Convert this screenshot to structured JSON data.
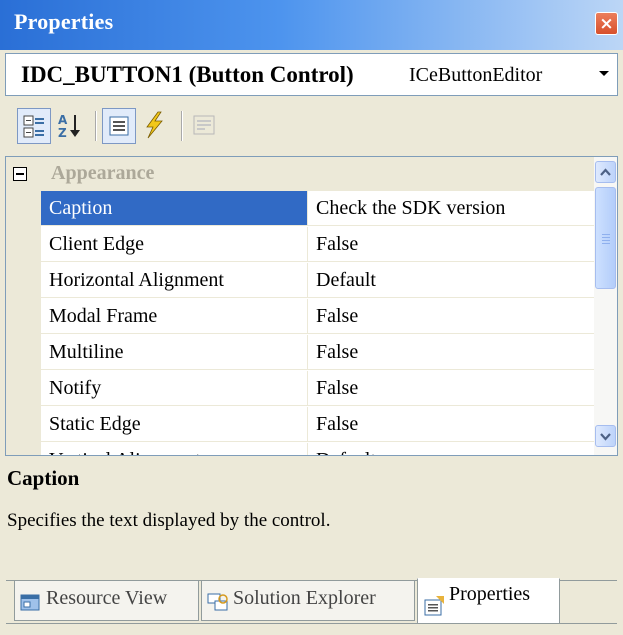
{
  "window": {
    "title": "Properties",
    "close_glyph": "×"
  },
  "object_selector": {
    "name": "IDC_BUTTON1",
    "type": "(Button Control)",
    "editor": "ICeButtonEditor"
  },
  "toolbar": {
    "buttons": [
      {
        "icon": "categorized-icon",
        "state": "pressed"
      },
      {
        "icon": "alphabetical-icon",
        "state": "normal"
      },
      {
        "icon": "properties-icon",
        "state": "pressed"
      },
      {
        "icon": "events-icon",
        "state": "normal"
      },
      {
        "icon": "property-pages-icon",
        "state": "disabled"
      }
    ]
  },
  "grid": {
    "category": {
      "label": "Appearance",
      "expanded": true
    },
    "rows": [
      {
        "name": "Caption",
        "value": "Check the SDK version",
        "selected": true
      },
      {
        "name": "Client Edge",
        "value": "False"
      },
      {
        "name": "Horizontal Alignment",
        "value": "Default"
      },
      {
        "name": "Modal Frame",
        "value": "False"
      },
      {
        "name": "Multiline",
        "value": "False"
      },
      {
        "name": "Notify",
        "value": "False"
      },
      {
        "name": "Static Edge",
        "value": "False"
      },
      {
        "name": "Vertical Alignment",
        "value": "Default"
      }
    ]
  },
  "description": {
    "title": "Caption",
    "text": "Specifies the text displayed by the control."
  },
  "tabs": [
    {
      "label": "Resource View",
      "icon": "resource-view-icon",
      "active": false
    },
    {
      "label": "Solution Explorer",
      "icon": "solution-explorer-icon",
      "active": false
    },
    {
      "label": "Properties",
      "icon": "properties-tab-icon",
      "active": true
    }
  ],
  "colors": {
    "selection": "#316ac5",
    "titlebar": "#2a6fd6",
    "category_text": "#aca899"
  }
}
